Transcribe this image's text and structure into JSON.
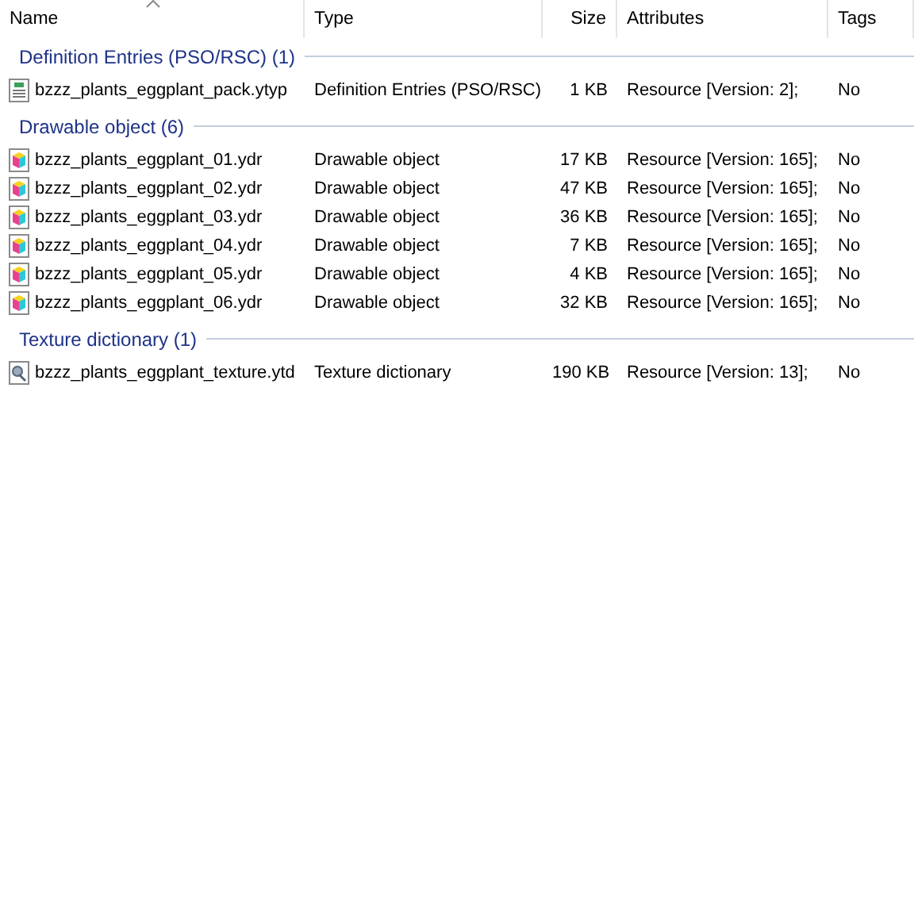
{
  "columns": [
    {
      "label": "Name",
      "sorted": true
    },
    {
      "label": "Type",
      "sorted": false
    },
    {
      "label": "Size",
      "sorted": false
    },
    {
      "label": "Attributes",
      "sorted": false
    },
    {
      "label": "Tags",
      "sorted": false
    }
  ],
  "groups": [
    {
      "title": "Definition Entries (PSO/RSC) (1)",
      "files": [
        {
          "kind": "ytyp",
          "name": "bzzz_plants_eggplant_pack.ytyp",
          "type": "Definition Entries (PSO/RSC)",
          "size": "1 KB",
          "attributes": "Resource [Version: 2];",
          "tags": "No"
        }
      ]
    },
    {
      "title": "Drawable object (6)",
      "files": [
        {
          "kind": "ydr",
          "name": "bzzz_plants_eggplant_01.ydr",
          "type": "Drawable object",
          "size": "17 KB",
          "attributes": "Resource [Version: 165];",
          "tags": "No"
        },
        {
          "kind": "ydr",
          "name": "bzzz_plants_eggplant_02.ydr",
          "type": "Drawable object",
          "size": "47 KB",
          "attributes": "Resource [Version: 165];",
          "tags": "No"
        },
        {
          "kind": "ydr",
          "name": "bzzz_plants_eggplant_03.ydr",
          "type": "Drawable object",
          "size": "36 KB",
          "attributes": "Resource [Version: 165];",
          "tags": "No"
        },
        {
          "kind": "ydr",
          "name": "bzzz_plants_eggplant_04.ydr",
          "type": "Drawable object",
          "size": "7 KB",
          "attributes": "Resource [Version: 165];",
          "tags": "No"
        },
        {
          "kind": "ydr",
          "name": "bzzz_plants_eggplant_05.ydr",
          "type": "Drawable object",
          "size": "4 KB",
          "attributes": "Resource [Version: 165];",
          "tags": "No"
        },
        {
          "kind": "ydr",
          "name": "bzzz_plants_eggplant_06.ydr",
          "type": "Drawable object",
          "size": "32 KB",
          "attributes": "Resource [Version: 165];",
          "tags": "No"
        }
      ]
    },
    {
      "title": "Texture dictionary (1)",
      "files": [
        {
          "kind": "ytd",
          "name": "bzzz_plants_eggplant_texture.ytd",
          "type": "Texture dictionary",
          "size": "190 KB",
          "attributes": "Resource [Version: 13];",
          "tags": "No"
        }
      ]
    }
  ]
}
